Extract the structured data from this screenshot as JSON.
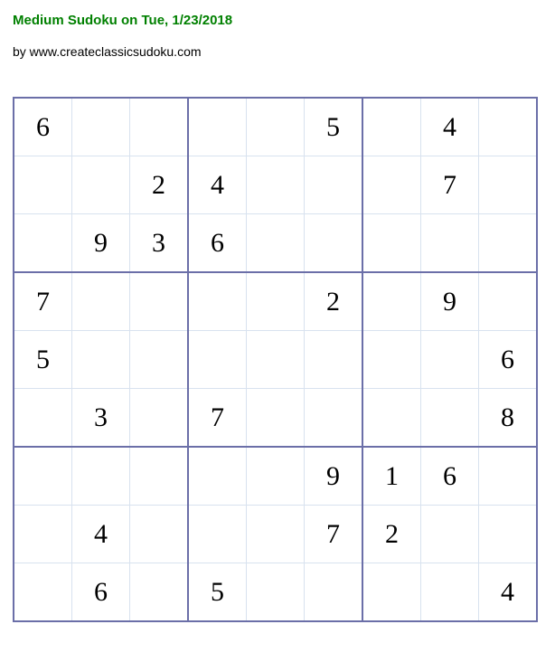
{
  "title": "Medium Sudoku on Tue, 1/23/2018",
  "byline": "by www.createclassicsudoku.com",
  "grid": [
    [
      "6",
      "",
      "",
      "",
      "",
      "5",
      "",
      "4",
      ""
    ],
    [
      "",
      "",
      "2",
      "4",
      "",
      "",
      "",
      "7",
      ""
    ],
    [
      "",
      "9",
      "3",
      "6",
      "",
      "",
      "",
      "",
      ""
    ],
    [
      "7",
      "",
      "",
      "",
      "",
      "2",
      "",
      "9",
      ""
    ],
    [
      "5",
      "",
      "",
      "",
      "",
      "",
      "",
      "",
      "6"
    ],
    [
      "",
      "3",
      "",
      "7",
      "",
      "",
      "",
      "",
      "8"
    ],
    [
      "",
      "",
      "",
      "",
      "",
      "9",
      "1",
      "6",
      ""
    ],
    [
      "",
      "4",
      "",
      "",
      "",
      "7",
      "2",
      "",
      ""
    ],
    [
      "",
      "6",
      "",
      "5",
      "",
      "",
      "",
      "",
      "4"
    ]
  ]
}
